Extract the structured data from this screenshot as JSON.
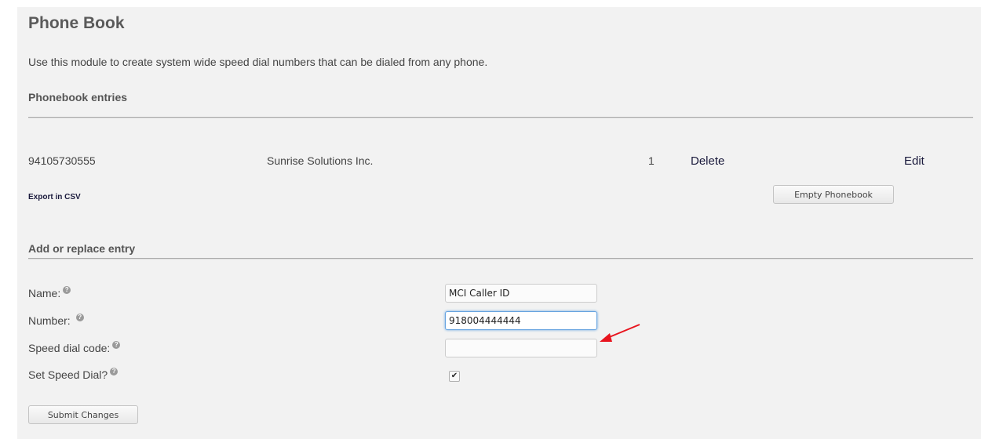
{
  "page": {
    "title": "Phone Book",
    "description": "Use this module to create system wide speed dial numbers that can be dialed from any phone."
  },
  "entries_section": {
    "heading": "Phonebook entries",
    "rows": [
      {
        "number": "94105730555",
        "name": "Sunrise Solutions Inc.",
        "speed_dial": "1",
        "delete_label": "Delete",
        "edit_label": "Edit"
      }
    ],
    "export_label": "Export in CSV",
    "empty_button_label": "Empty Phonebook"
  },
  "form": {
    "heading": "Add or replace entry",
    "name_label": "Name:",
    "name_value": "MCI Caller ID",
    "number_label": "Number:",
    "number_value": "918004444444",
    "speed_dial_label": "Speed dial code:",
    "speed_dial_value": "",
    "set_speed_dial_label": "Set Speed Dial?",
    "set_speed_dial_checked": true,
    "submit_label": "Submit Changes"
  },
  "icons": {
    "help": "help-icon",
    "check": "check-icon",
    "annotation_arrow": "red-arrow-icon"
  },
  "colors": {
    "panel_background": "#f2f2f2",
    "link": "#1a1a3c",
    "focus_border": "#66a3e0",
    "annotation_arrow": "#e8141e"
  }
}
